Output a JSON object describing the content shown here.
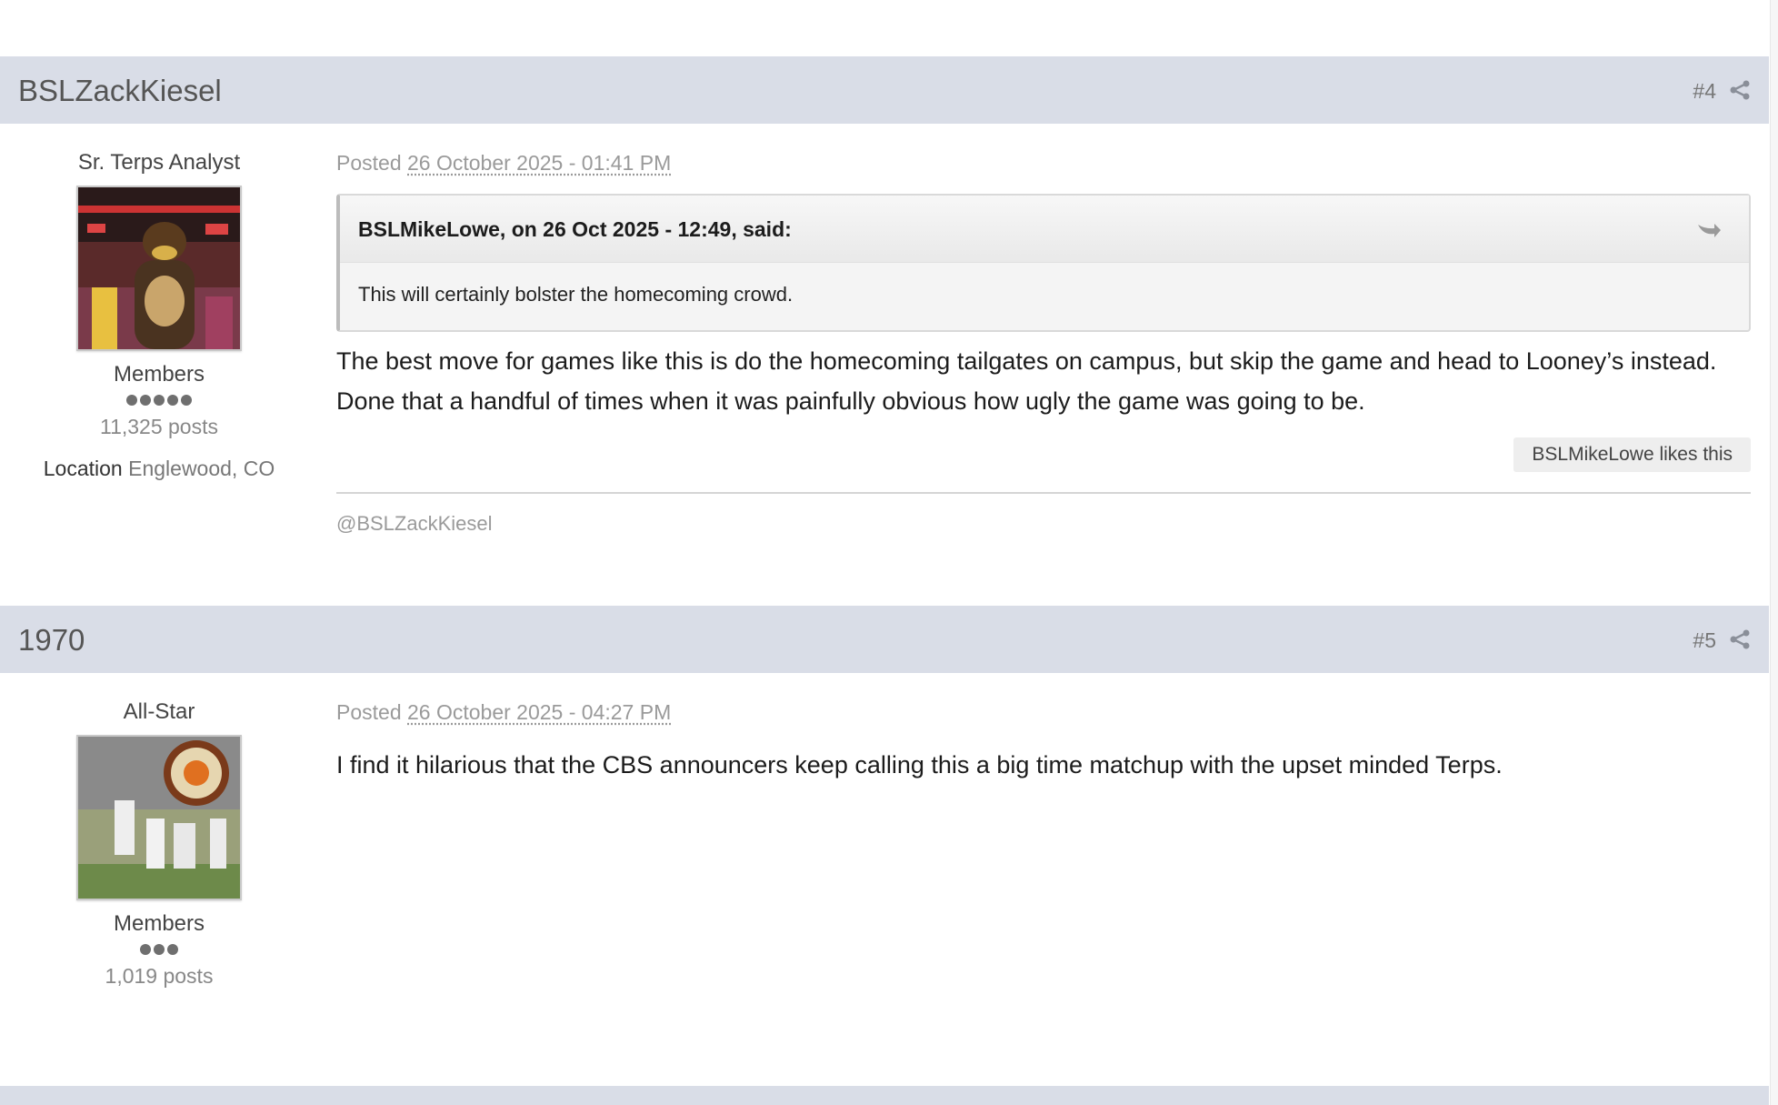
{
  "posts": [
    {
      "author": "BSLZackKiesel",
      "number": "#4",
      "title": "Sr. Terps Analyst",
      "group": "Members",
      "pips": 5,
      "post_count": "11,325 posts",
      "location_label": "Location",
      "location_value": "Englewood, CO",
      "posted_label": "Posted",
      "date": "26 October 2025 - 01:41 PM",
      "quote": {
        "citation": "BSLMikeLowe, on 26 Oct 2025 - 12:49, said:",
        "text": "This will certainly bolster the homecoming crowd."
      },
      "content": "The best move for games like this is do the homecoming tailgates on campus, but skip the game and head to Looney’s instead. Done that a handful of times when it was painfully obvious how ugly the game was going to be.",
      "likes": "BSLMikeLowe likes this",
      "signature": "@BSLZackKiesel"
    },
    {
      "author": "1970",
      "number": "#5",
      "title": "All-Star",
      "group": "Members",
      "pips": 3,
      "post_count": "1,019 posts",
      "posted_label": "Posted",
      "date": "26 October 2025 - 04:27 PM",
      "content": "I find it hilarious that the CBS announcers keep calling this a big time matchup with the upset minded Terps."
    }
  ],
  "colors": {
    "header_bg": "#d9dde7",
    "pip": "#6f6f6f",
    "muted_text": "#9a9a9a"
  },
  "icons": {
    "share": "share-icon",
    "quote_jump": "quote-jump-icon"
  }
}
